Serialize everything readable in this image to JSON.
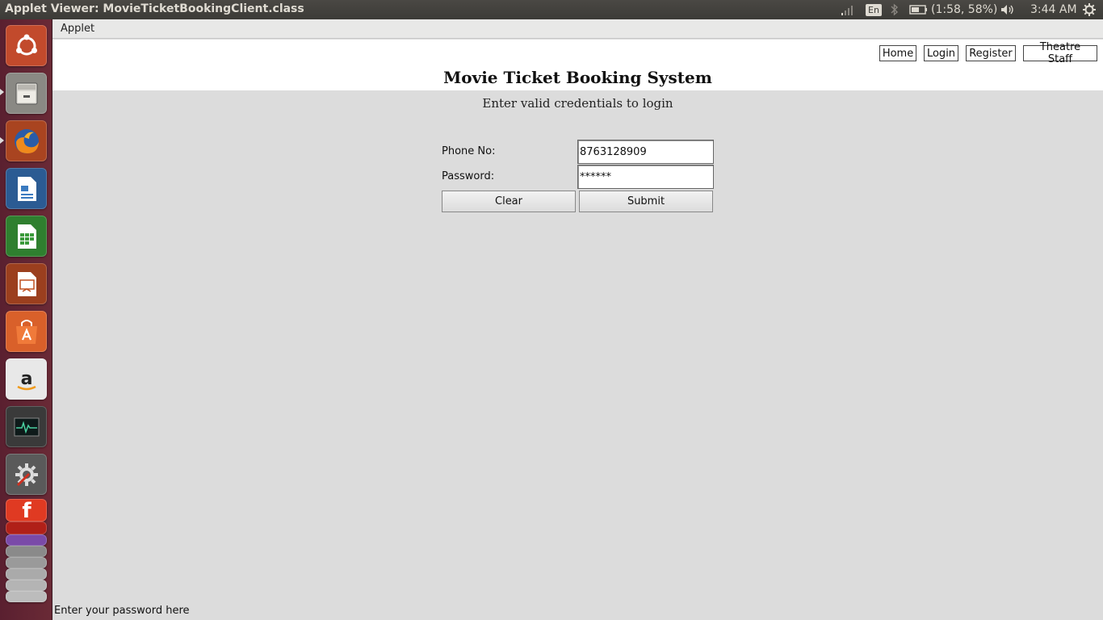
{
  "panel": {
    "window_title": "Applet Viewer: MovieTicketBookingClient.class",
    "keyboard_layout": "En",
    "battery": "(1:58, 58%)",
    "clock": "3:44 AM"
  },
  "launcher": {
    "items": [
      {
        "name": "ubuntu-dash-icon",
        "color": "#c04a2a"
      },
      {
        "name": "files-icon",
        "color": "#9a9a96"
      },
      {
        "name": "firefox-icon",
        "color": "#e66000"
      },
      {
        "name": "writer-icon",
        "color": "#2a6fb0"
      },
      {
        "name": "calc-icon",
        "color": "#3a9a3a"
      },
      {
        "name": "impress-icon",
        "color": "#c05020"
      },
      {
        "name": "software-center-icon",
        "color": "#e06a2a"
      },
      {
        "name": "amazon-icon",
        "color": "#f2f2f2"
      },
      {
        "name": "system-monitor-icon",
        "color": "#2a2a2a"
      },
      {
        "name": "system-settings-icon",
        "color": "#6a6a6a"
      },
      {
        "name": "filezilla-icon",
        "color": "#e03020"
      }
    ]
  },
  "menubar": {
    "applet_menu": "Applet"
  },
  "nav": {
    "home": "Home",
    "login": "Login",
    "register": "Register",
    "theatre_staff": "Theatre Staff"
  },
  "page": {
    "title": "Movie Ticket Booking System",
    "subtitle": "Enter valid credentials to login"
  },
  "form": {
    "phone_label": "Phone No:",
    "phone_value": "8763128909",
    "password_label": "Password:",
    "password_value": "******",
    "clear_label": "Clear",
    "submit_label": "Submit"
  },
  "status": {
    "text": "Enter your password here"
  }
}
